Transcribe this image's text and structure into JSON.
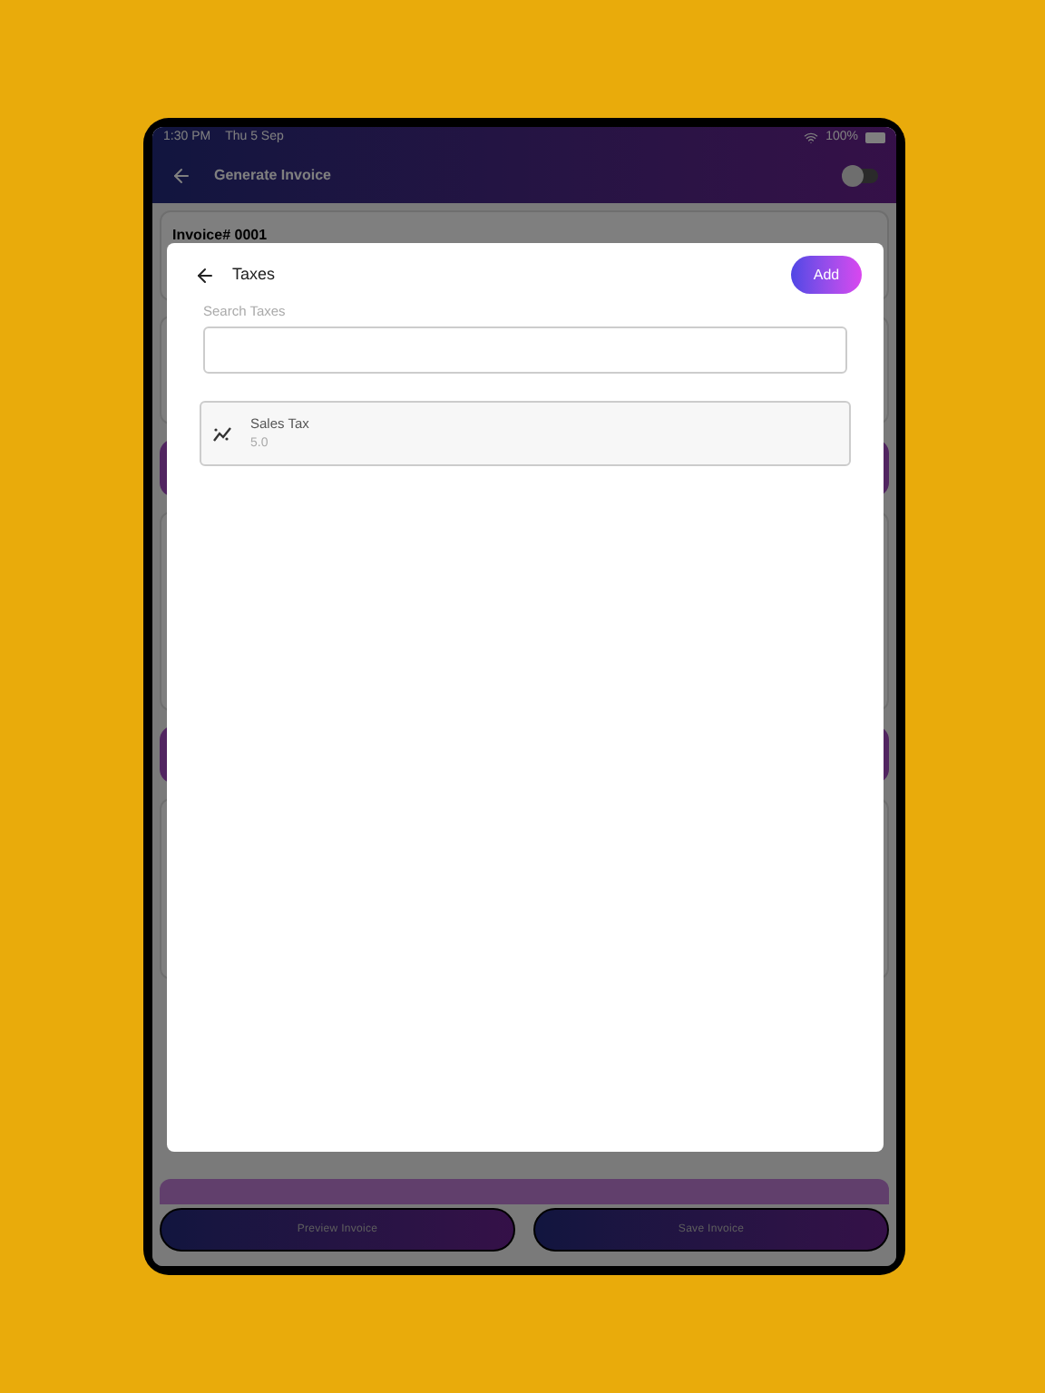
{
  "status_bar": {
    "time": "1:30 PM",
    "date": "Thu 5 Sep",
    "battery": "100%"
  },
  "header": {
    "title": "Generate Invoice",
    "toggle": {
      "on": false
    }
  },
  "background": {
    "invoice_number": "Invoice# 0001",
    "buttons": [
      "Preview Invoice",
      "Save Invoice"
    ]
  },
  "dialog": {
    "title": "Taxes",
    "add_button": "Add",
    "search": {
      "label": "Search Taxes"
    },
    "taxes": [
      {
        "name": "Sales Tax",
        "rate": "5.0"
      }
    ]
  }
}
